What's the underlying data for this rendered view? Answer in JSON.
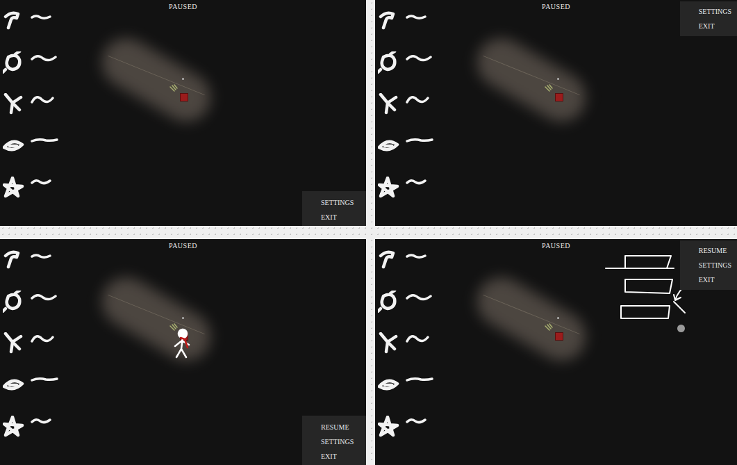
{
  "panels": [
    {
      "title": "PAUSED",
      "kind": "bottom",
      "menu": [
        "SETTINGS",
        "EXIT"
      ]
    },
    {
      "title": "PAUSED",
      "kind": "top",
      "menu": [
        "SETTINGS",
        "EXIT"
      ]
    },
    {
      "title": "PAUSED",
      "kind": "figure",
      "menu": [
        "RESUME",
        "SETTINGS",
        "EXIT"
      ]
    },
    {
      "title": "PAUSED",
      "kind": "sketch",
      "menu": [
        "RESUME",
        "SETTINGS",
        "EXIT"
      ]
    }
  ]
}
